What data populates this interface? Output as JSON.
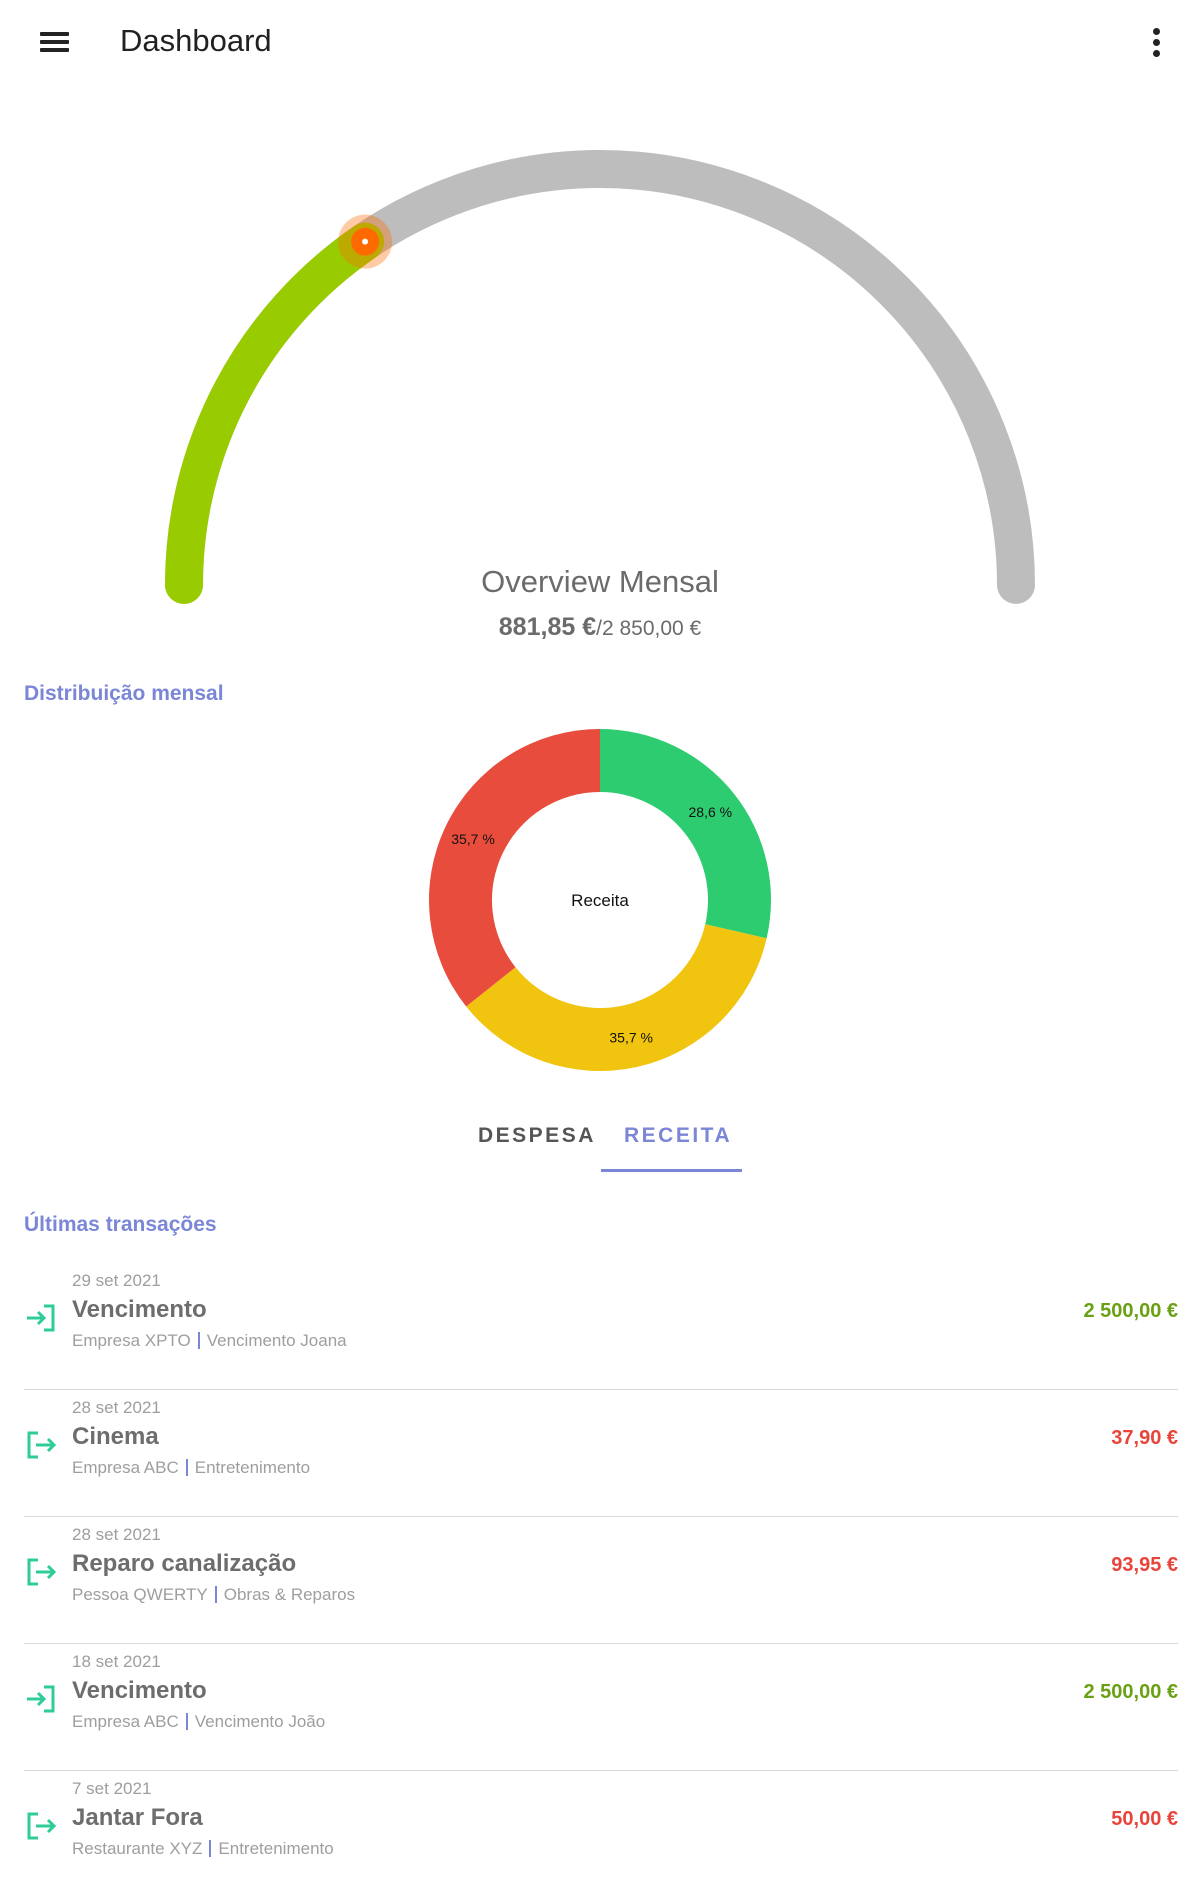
{
  "appbar": {
    "title": "Dashboard",
    "menu_icon": "menu-icon",
    "more_icon": "more-vert-icon"
  },
  "overview": {
    "title": "Overview Mensal",
    "current": "881,85 €",
    "total": "/2 850,00 €",
    "progress_fraction": 0.309,
    "colors": {
      "progress": "#99cc00",
      "track": "#bdbdbd",
      "thumb": "#ff6a00"
    }
  },
  "distribution": {
    "section_title": "Distribuição mensal",
    "center_label": "Receita",
    "chart_data": {
      "type": "pie",
      "variant": "donut",
      "slices": [
        {
          "label": "28,6 %",
          "value": 28.6,
          "color": "#2ecc71"
        },
        {
          "label": "35,7 %",
          "value": 35.7,
          "color": "#f1c40f"
        },
        {
          "label": "35,7 %",
          "value": 35.7,
          "color": "#e74c3c"
        }
      ]
    }
  },
  "tabs": [
    {
      "label": "DESPESA",
      "active": false
    },
    {
      "label": "RECEITA",
      "active": true
    }
  ],
  "transactions": {
    "section_title": "Últimas transações",
    "items": [
      {
        "date": "29 set 2021",
        "name": "Vencimento",
        "entity": "Empresa XPTO",
        "category": "Vencimento Joana",
        "amount": "2 500,00 €",
        "type": "income",
        "icon": "login-icon"
      },
      {
        "date": "28 set 2021",
        "name": "Cinema",
        "entity": "Empresa ABC",
        "category": "Entretenimento",
        "amount": "37,90 €",
        "type": "expense",
        "icon": "logout-icon"
      },
      {
        "date": "28 set 2021",
        "name": "Reparo canalização",
        "entity": "Pessoa QWERTY",
        "category": "Obras & Reparos",
        "amount": "93,95 €",
        "type": "expense",
        "icon": "logout-icon"
      },
      {
        "date": "18 set 2021",
        "name": "Vencimento",
        "entity": "Empresa ABC",
        "category": "Vencimento João",
        "amount": "2 500,00 €",
        "type": "income",
        "icon": "login-icon"
      },
      {
        "date": "7 set 2021",
        "name": "Jantar Fora",
        "entity": "Restaurante XYZ",
        "category": "Entretenimento",
        "amount": "50,00 €",
        "type": "expense",
        "icon": "logout-icon"
      }
    ]
  }
}
